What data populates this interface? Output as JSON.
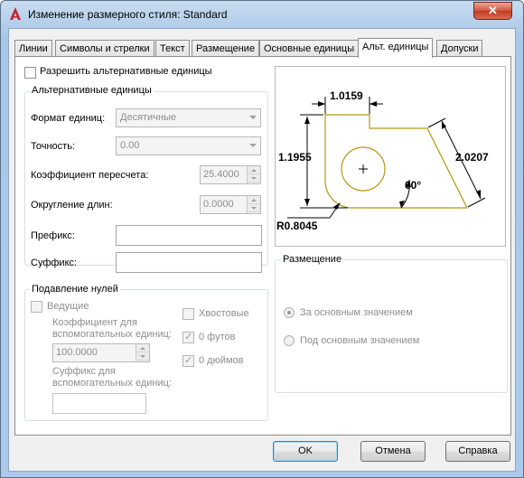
{
  "window": {
    "title": "Изменение размерного стиля: Standard",
    "close_symbol": "✕"
  },
  "tabs": [
    {
      "label": "Линии"
    },
    {
      "label": "Символы и стрелки"
    },
    {
      "label": "Текст"
    },
    {
      "label": "Размещение"
    },
    {
      "label": "Основные единицы"
    },
    {
      "label": "Альт. единицы",
      "active": true
    },
    {
      "label": "Допуски"
    }
  ],
  "enable_alt": {
    "label": "Разрешить альтернативные единицы",
    "checked": false
  },
  "alt_units": {
    "title": "Альтернативные единицы",
    "format_label": "Формат единиц:",
    "format_value": "Десятичные",
    "precision_label": "Точность:",
    "precision_value": "0.00",
    "multiplier_label": "Коэффициент пересчета:",
    "multiplier_value": "25.4000",
    "round_label": "Округление длин:",
    "round_value": "0.0000",
    "prefix_label": "Префикс:",
    "prefix_value": "",
    "suffix_label": "Суффикс:",
    "suffix_value": ""
  },
  "zero_suppression": {
    "title": "Подавление нулей",
    "leading_label": "Ведущие",
    "leading_checked": false,
    "sub_factor_label_1": "Коэффициент для",
    "sub_factor_label_2": "вспомогательных единиц:",
    "sub_factor_value": "100.0000",
    "sub_suffix_label_1": "Суффикс для",
    "sub_suffix_label_2": "вспомогательных единиц:",
    "sub_suffix_value": "",
    "trailing_label": "Хвостовые",
    "trailing_checked": false,
    "feet_label": "0 футов",
    "feet_checked": true,
    "inches_label": "0 дюймов",
    "inches_checked": true
  },
  "preview": {
    "dim_top": "1.0159",
    "dim_left": "1.1955",
    "dim_right": "2.0207",
    "angle": "60°",
    "radius": "R0.8045",
    "outline_color": "#b8960c"
  },
  "placement": {
    "title": "Размещение",
    "after_label": "За основным значением",
    "after_selected": true,
    "below_label": "Под основным значением",
    "below_selected": false
  },
  "buttons": {
    "ok": "OK",
    "cancel": "Отмена",
    "help": "Справка"
  }
}
